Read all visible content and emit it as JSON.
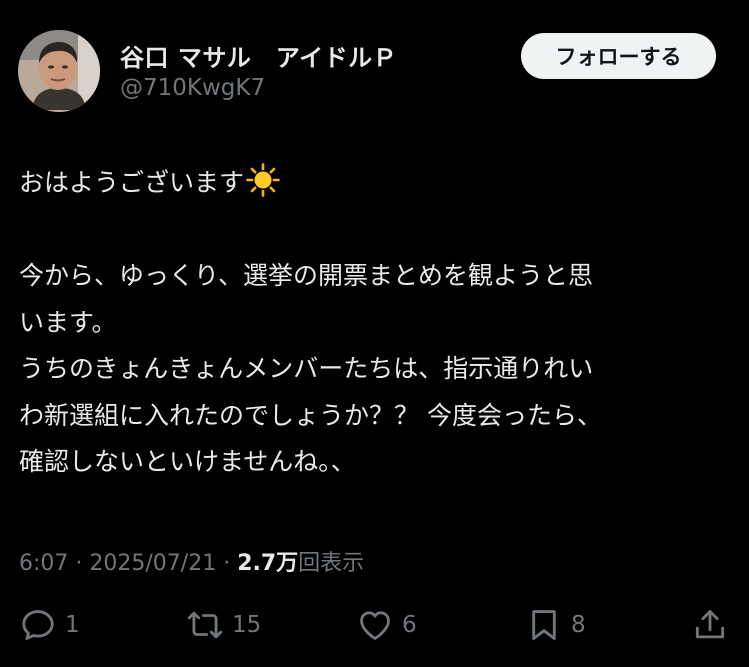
{
  "author": {
    "display_name": "谷口 マサル　アイドルＰ",
    "handle": "@710KwgK7",
    "follow_label": "フォローする"
  },
  "tweet": {
    "line1": "おはようございます",
    "emoji": "sun-emoji",
    "paragraph2_line1": "今から、ゆっくり、選挙の開票まとめを観ようと思",
    "paragraph2_line2": "います。",
    "paragraph2_line3": "うちのきょんきょんメンバーたちは、指示通りれい",
    "paragraph2_line4": "わ新選組に入れたのでしょうか？？ 今度会ったら、",
    "paragraph2_line5": "確認しないといけませんね。、"
  },
  "meta": {
    "time": "6:07",
    "date": "2025/07/21",
    "separator": " · ",
    "views_count": "2.7万",
    "views_label": "回表示"
  },
  "actions": {
    "reply": {
      "icon": "reply-icon",
      "count": "1"
    },
    "retweet": {
      "icon": "retweet-icon",
      "count": "15"
    },
    "like": {
      "icon": "heart-icon",
      "count": "6"
    },
    "bookmark": {
      "icon": "bookmark-icon",
      "count": "8"
    },
    "share": {
      "icon": "share-icon"
    }
  },
  "colors": {
    "background": "#000000",
    "text": "#e7e9ea",
    "secondary": "#71767b",
    "button_bg": "#eff3f4"
  }
}
